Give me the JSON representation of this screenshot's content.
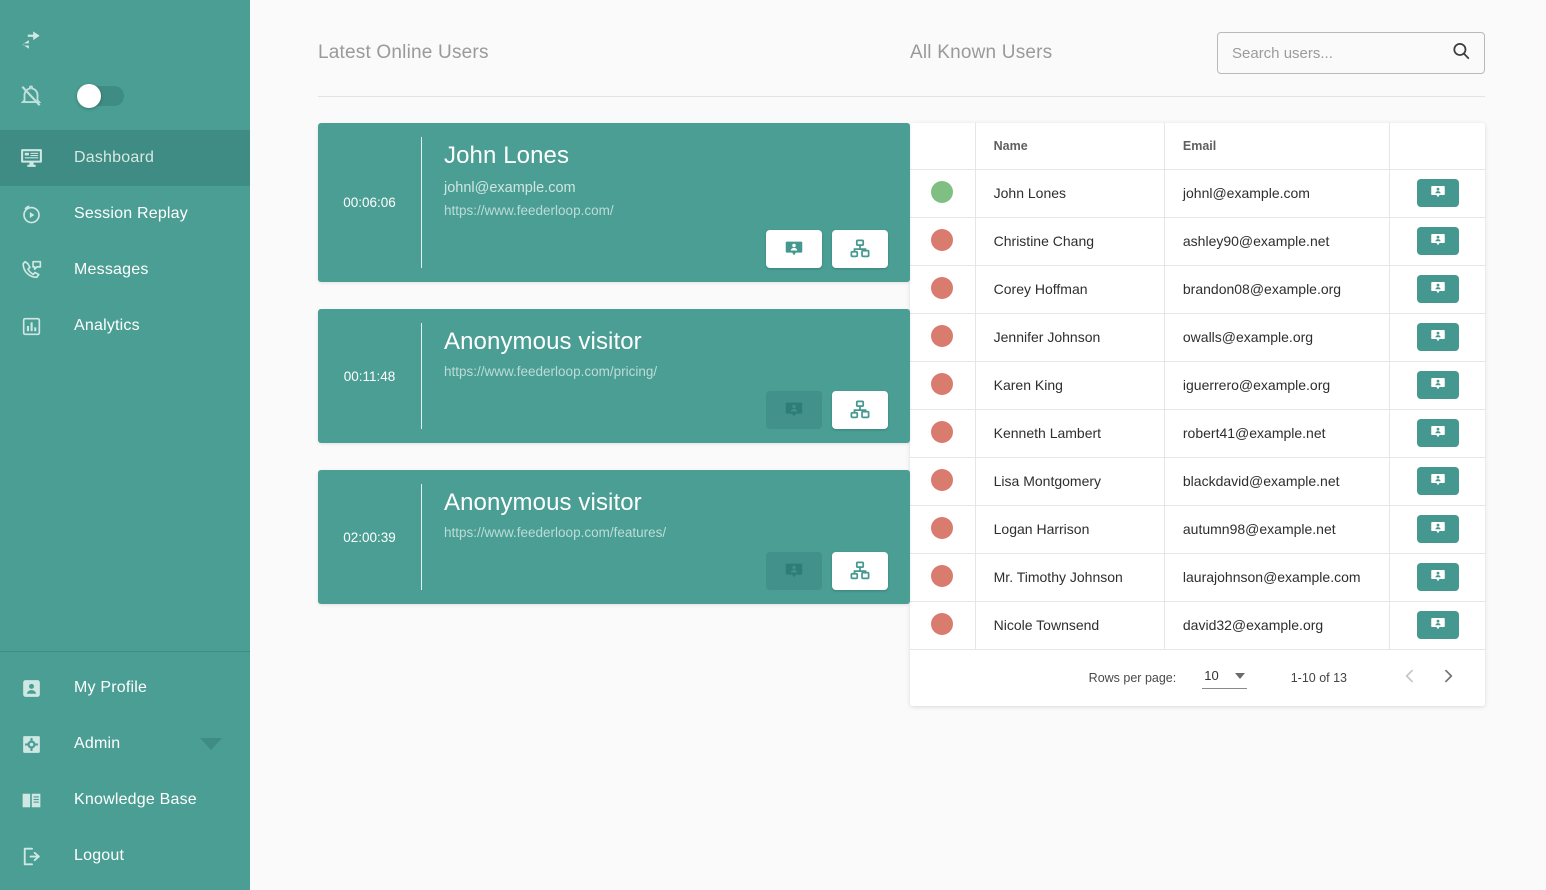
{
  "sidebar": {
    "top_icons": [
      {
        "name": "sync-arrows-icon"
      },
      {
        "name": "notifications-off-icon"
      }
    ],
    "toggle": {
      "name": "notifications-toggle",
      "state": "off"
    },
    "nav": [
      {
        "label": "Dashboard",
        "icon": "dashboard-monitor-icon",
        "active": true
      },
      {
        "label": "Session Replay",
        "icon": "play-circle-icon",
        "active": false
      },
      {
        "label": "Messages",
        "icon": "phone-message-icon",
        "active": false
      },
      {
        "label": "Analytics",
        "icon": "bar-chart-icon",
        "active": false
      }
    ],
    "bottom_nav": [
      {
        "label": "My Profile",
        "icon": "person-box-icon",
        "has_caret": false
      },
      {
        "label": "Admin",
        "icon": "gear-icon",
        "has_caret": true
      },
      {
        "label": "Knowledge Base",
        "icon": "open-book-icon",
        "has_caret": false
      },
      {
        "label": "Logout",
        "icon": "logout-arrow-icon",
        "has_caret": false
      }
    ]
  },
  "online": {
    "title": "Latest Online Users",
    "cards": [
      {
        "time": "00:06:06",
        "name": "John Lones",
        "email": "johnl@example.com",
        "url": "https://www.feederloop.com/",
        "chat_enabled": true,
        "chat_icon": "chat-person-icon",
        "screen_icon": "screen-share-icon"
      },
      {
        "time": "00:11:48",
        "name": "Anonymous visitor",
        "email": "",
        "url": "https://www.feederloop.com/pricing/",
        "chat_enabled": false,
        "chat_icon": "chat-person-icon",
        "screen_icon": "screen-share-icon"
      },
      {
        "time": "02:00:39",
        "name": "Anonymous visitor",
        "email": "",
        "url": "https://www.feederloop.com/features/",
        "chat_enabled": false,
        "chat_icon": "chat-person-icon",
        "screen_icon": "screen-share-icon"
      }
    ]
  },
  "known": {
    "title": "All Known Users",
    "search": {
      "value": "",
      "placeholder": "Search users...",
      "icon": "search-icon"
    },
    "columns": [
      "",
      "Name",
      "Email",
      ""
    ],
    "rows": [
      {
        "status": "online",
        "name": "John Lones",
        "email": "johnl@example.com"
      },
      {
        "status": "offline",
        "name": "Christine Chang",
        "email": "ashley90@example.net"
      },
      {
        "status": "offline",
        "name": "Corey Hoffman",
        "email": "brandon08@example.org"
      },
      {
        "status": "offline",
        "name": "Jennifer Johnson",
        "email": "owalls@example.org"
      },
      {
        "status": "offline",
        "name": "Karen King",
        "email": "iguerrero@example.org"
      },
      {
        "status": "offline",
        "name": "Kenneth Lambert",
        "email": "robert41@example.net"
      },
      {
        "status": "offline",
        "name": "Lisa Montgomery",
        "email": "blackdavid@example.net"
      },
      {
        "status": "offline",
        "name": "Logan Harrison",
        "email": "autumn98@example.net"
      },
      {
        "status": "offline",
        "name": "Mr. Timothy Johnson",
        "email": "laurajohnson@example.com"
      },
      {
        "status": "offline",
        "name": "Nicole Townsend",
        "email": "david32@example.org"
      }
    ],
    "row_action_icon": "chat-person-icon",
    "pagination": {
      "rows_per_page_label": "Rows per page:",
      "rows_per_page_value": "10",
      "range": "1-10 of 13",
      "prev_icon": "chevron-left-icon",
      "next_icon": "chevron-right-icon",
      "prev_enabled": false,
      "next_enabled": true
    }
  },
  "colors": {
    "teal": "#4a9e94",
    "teal_dark": "#3e8c83",
    "online_dot": "#7fc082",
    "offline_dot": "#da7b70",
    "page_bg": "#fafafa"
  }
}
